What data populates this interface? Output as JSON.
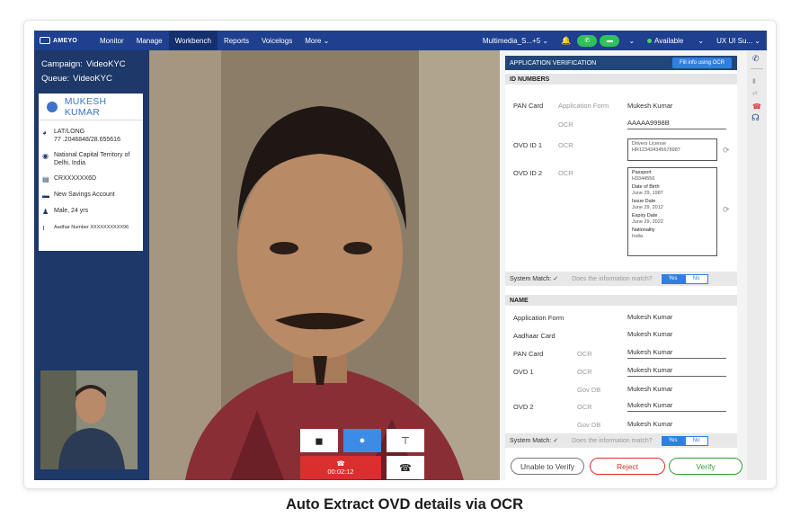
{
  "nav": {
    "logo": "AMEYO",
    "items": [
      "Monitor",
      "Manage",
      "Workbench",
      "Reports",
      "Voicelogs",
      "More ⌄"
    ],
    "active_index": 2,
    "campaign_selector": "Multimedia_S...+5 ⌄",
    "status": "Available",
    "user": "UX UI Su... ⌄"
  },
  "sidebar": {
    "campaign_label": "Campaign:",
    "campaign_value": "VideoKYC",
    "queue_label": "Queue:",
    "queue_value": "VideoKYC",
    "customer_name": "MUKESH KUMAR",
    "latlong_label": "LAT/LONG",
    "latlong_value": "77 .2046848/28.655616",
    "location": "National Capital Territory of Delhi, India",
    "account_id": "CRXXXXXX6D",
    "account_type": "New Savings Account",
    "demographics": "Male, 24 yrs",
    "aadhar": "Aadhar Number XXXXXXXXXX96"
  },
  "call": {
    "timer": "00:02:12"
  },
  "panel": {
    "title": "APPLICATION VERIFICATION",
    "ocr_button": "Fill info using OCR",
    "id_section": "ID NUMBERS",
    "pan_label": "PAN Card",
    "app_form_label": "Application Form",
    "ocr_label": "OCR",
    "pan_app_value": "Mukesh Kumar",
    "pan_ocr_value": "AAAAA9998B",
    "ovd1_label": "OVD ID 1",
    "ovd1_box_title": "Drivers License",
    "ovd1_box_value": "HR123434345678987",
    "ovd2_label": "OVD ID 2",
    "ovd2_fields": [
      {
        "k": "Passport",
        "v": "H3344556"
      },
      {
        "k": "Date of Birth",
        "v": "June 29, 1987"
      },
      {
        "k": "Issue Date",
        "v": "June 29, 2012"
      },
      {
        "k": "Expiry Date",
        "v": "June 29, 2022"
      },
      {
        "k": "Nationality",
        "v": "India"
      }
    ],
    "system_match": "System Match: ✓",
    "match_question": "Does the information match?",
    "yes": "Yes",
    "no": "No",
    "name_section": "NAME",
    "name_rows": [
      {
        "label": "Application Form",
        "src": "",
        "value": "Mukesh Kumar"
      },
      {
        "label": "Aadhaar Card",
        "src": "",
        "value": "Mukesh Kumar"
      },
      {
        "label": "PAN Card",
        "src": "OCR",
        "value": "Mukesh Kumar"
      },
      {
        "label": "OVD 1",
        "src": "OCR",
        "value": "Mukesh Kumar"
      },
      {
        "label": "",
        "src": "Gov DB",
        "value": "Mukesh Kumar"
      },
      {
        "label": "OVD 2",
        "src": "OCR",
        "value": "Mukesh Kumar"
      },
      {
        "label": "",
        "src": "Gov DB",
        "value": "Mukesh Kumar"
      }
    ]
  },
  "actions": {
    "unable": "Unable to Verify",
    "reject": "Reject",
    "verify": "Verify"
  },
  "caption": "Auto Extract OVD details via OCR",
  "colors": {
    "nav": "#1f3f8f",
    "sidebar": "#1d3869",
    "accent": "#2f7fe3",
    "reject": "#d9302f",
    "verify": "#2f9e3a",
    "end_call": "#d9302f"
  }
}
